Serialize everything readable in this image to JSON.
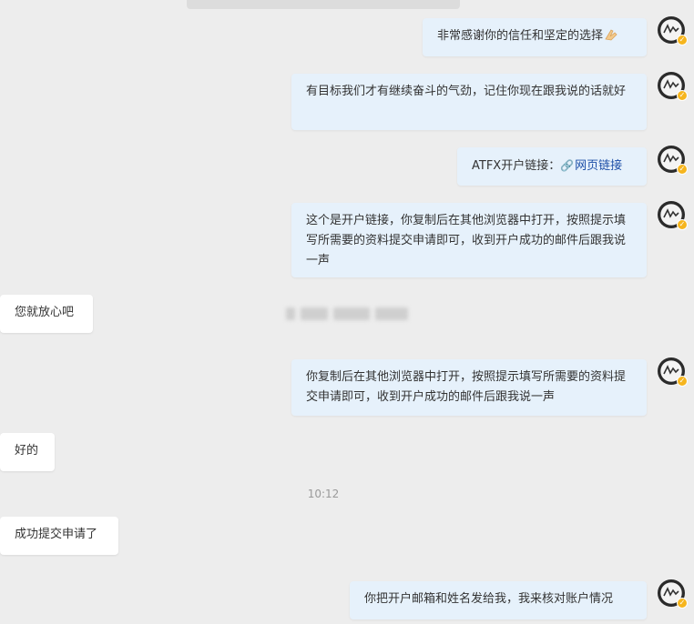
{
  "messages": [
    {
      "text": "非常感谢你的信任和坚定的选择",
      "emoji": "praying-hands-icon"
    },
    {
      "text": "有目标我们才有继续奋斗的气劲，记住你现在跟我说的话就好"
    },
    {
      "prefix": "ATFX开户链接：",
      "link": "网页链接",
      "link_icon": "link-icon"
    },
    {
      "text": "这个是开户链接，你复制后在其他浏览器中打开，按照提示填写所需要的资料提交申请即可，收到开户成功的邮件后跟我说一声"
    },
    {
      "text": "您就放心吧"
    },
    {
      "text": "你复制后在其他浏览器中打开，按照提示填写所需要的资料提交申请即可，收到开户成功的邮件后跟我说一声"
    },
    {
      "text": "好的"
    },
    {
      "text": "成功提交申请了"
    },
    {
      "text": "你把开户邮箱和姓名发给我，我来核对账户情况"
    }
  ],
  "timestamp": "10:12",
  "colors": {
    "background": "#ededed",
    "outgoing_bubble": "#e6f1fb",
    "incoming_bubble": "#ffffff",
    "link": "#1d4fa8",
    "badge": "#f6b51e"
  }
}
